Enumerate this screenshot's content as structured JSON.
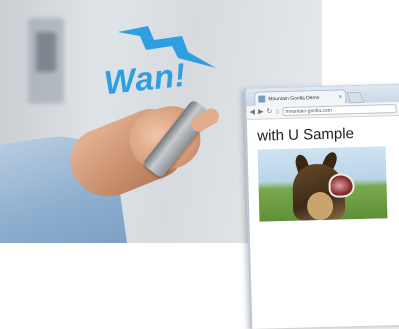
{
  "hero": {
    "caption": "Wan!",
    "caption_color": "#2e9fe0",
    "bolt_color": "#2e9fe0"
  },
  "browser": {
    "tab_title": "Mountain Gorilla Demo",
    "tab_close_icon": "close-icon",
    "address": "mountain-gorilla.com",
    "toolbar_icons": [
      "back-icon",
      "forward-icon",
      "reload-icon",
      "home-icon"
    ],
    "page_heading": "with U Sample",
    "image_alt_subject": "barking dog"
  }
}
